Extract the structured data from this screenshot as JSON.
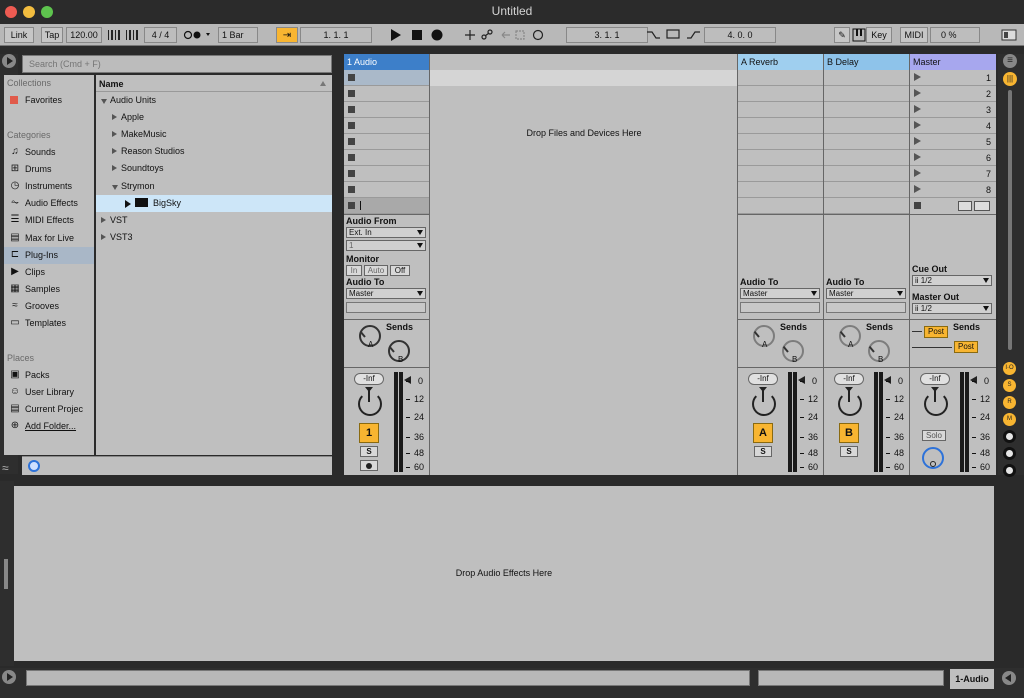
{
  "window": {
    "title": "Untitled"
  },
  "control_bar": {
    "link": "Link",
    "tap": "Tap",
    "tempo": "120.00",
    "time_sig": "4 / 4",
    "quantize": "1 Bar",
    "arrangement_pos": "1.  1.  1",
    "loop_start": "3.  1.  1",
    "loop_length": "4.  0.  0",
    "key": "Key",
    "midi": "MIDI",
    "cpu": "0 %"
  },
  "browser": {
    "search_placeholder": "Search (Cmd + F)",
    "collections_header": "Collections",
    "favorites": "Favorites",
    "categories_header": "Categories",
    "categories": [
      "Sounds",
      "Drums",
      "Instruments",
      "Audio Effects",
      "MIDI Effects",
      "Max for Live",
      "Plug-Ins",
      "Clips",
      "Samples",
      "Grooves",
      "Templates"
    ],
    "places_header": "Places",
    "places": [
      "Packs",
      "User Library",
      "Current Projec",
      "Add Folder..."
    ],
    "name_header": "Name",
    "tree": [
      {
        "label": "Audio Units",
        "indent": 0,
        "open": true
      },
      {
        "label": "Apple",
        "indent": 1,
        "open": false
      },
      {
        "label": "MakeMusic",
        "indent": 1,
        "open": false
      },
      {
        "label": "Reason Studios",
        "indent": 1,
        "open": false
      },
      {
        "label": "Soundtoys",
        "indent": 1,
        "open": false
      },
      {
        "label": "Strymon",
        "indent": 1,
        "open": true
      },
      {
        "label": "BigSky",
        "indent": 2,
        "open": false,
        "selected": true
      },
      {
        "label": "VST",
        "indent": 0,
        "open": false
      },
      {
        "label": "VST3",
        "indent": 0,
        "open": false
      }
    ]
  },
  "session": {
    "drop_text": "Drop Files and Devices Here",
    "tracks": {
      "audio": {
        "name": "1 Audio",
        "color": "#3d7fc9",
        "number": "1"
      },
      "return_a": {
        "name": "A Reverb",
        "color": "#9fcfef",
        "letter": "A"
      },
      "return_b": {
        "name": "B Delay",
        "color": "#8ec3ea",
        "letter": "B"
      },
      "master": {
        "name": "Master",
        "color": "#a7a7ee"
      }
    },
    "scene_numbers": [
      "1",
      "2",
      "3",
      "4",
      "5",
      "6",
      "7",
      "8"
    ],
    "audio_from_label": "Audio From",
    "audio_from_value": "Ext. In",
    "audio_from_channel": "1",
    "monitor_label": "Monitor",
    "monitor_options": [
      "In",
      "Auto",
      "Off"
    ],
    "audio_to_label": "Audio To",
    "audio_to_value": "Master",
    "cue_out_label": "Cue Out",
    "cue_out_value": "1/2",
    "master_out_label": "Master Out",
    "master_out_value": "1/2",
    "sends_label": "Sends",
    "knob_a": "A",
    "knob_b": "B",
    "post_label": "Post",
    "volume": "-Inf",
    "solo_label": "S",
    "solo_master": "Solo",
    "meter_ticks": [
      "0",
      "12",
      "24",
      "36",
      "48",
      "60"
    ]
  },
  "detail": {
    "drop_text": "Drop Audio Effects Here"
  },
  "status": {
    "selected_track": "1-Audio"
  },
  "right_strip": {
    "buttons": [
      "I·O",
      "S",
      "R",
      "M"
    ]
  }
}
